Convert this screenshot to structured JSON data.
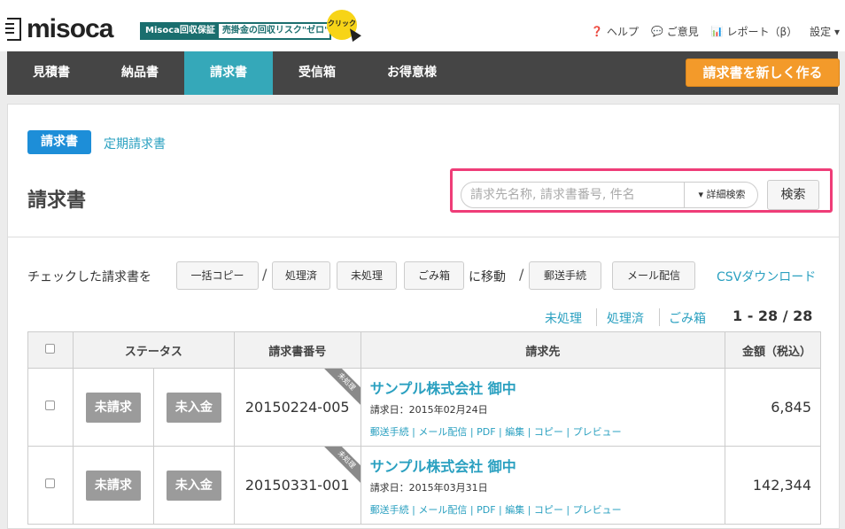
{
  "header": {
    "logo_text": "misoca",
    "banner_left": "Misoca回収保証",
    "banner_right": "売掛金の回収リスク\"ゼロ\"",
    "click_badge": "クリック",
    "utility": [
      {
        "icon": "help-icon",
        "glyph": "❓",
        "label": "ヘルプ"
      },
      {
        "icon": "feedback-icon",
        "glyph": "💬",
        "label": "ご意見"
      },
      {
        "icon": "report-icon",
        "glyph": "📊",
        "label": "レポート（β）"
      },
      {
        "icon": "settings-icon",
        "glyph": "",
        "label": "設定 ▾"
      }
    ]
  },
  "nav": {
    "tabs": [
      "見積書",
      "納品書",
      "請求書",
      "受信箱",
      "お得意様"
    ],
    "active": "請求書",
    "create_button": "請求書を新しく作る"
  },
  "subtabs": {
    "active": "請求書",
    "other": "定期請求書"
  },
  "page_title": "請求書",
  "search": {
    "placeholder": "請求先名称, 請求書番号, 件名",
    "detail_label": "▾ 詳細検索",
    "button": "検索"
  },
  "bulk_actions": {
    "label": "チェックした請求書を",
    "copy": "一括コピー",
    "sep": "/",
    "processed": "処理済",
    "unprocessed": "未処理",
    "trash": "ごみ箱",
    "move_to": "に移動",
    "sep2": "/",
    "mail_send": "郵送手続",
    "email_send": "メール配信",
    "csv": "CSVダウンロード"
  },
  "filters": [
    "未処理",
    "処理済",
    "ごみ箱"
  ],
  "pagination": "1 - 28 / 28",
  "table": {
    "headers": [
      "ステータス",
      "請求書番号",
      "請求先",
      "金額（税込）"
    ],
    "rows": [
      {
        "status1": "未請求",
        "status2": "未入金",
        "number": "20150224-005",
        "ribbon": "未処理",
        "client": "サンプル株式会社 御中",
        "date": "請求日：2015年02月24日",
        "links": "郵送手続 | メール配信 | PDF | 編集 | コピー | プレビュー",
        "amount": "6,845"
      },
      {
        "status1": "未請求",
        "status2": "未入金",
        "number": "20150331-001",
        "ribbon": "未処理",
        "client": "サンプル株式会社 御中",
        "date": "請求日：2015年03月31日",
        "links": "郵送手続 | メール配信 | PDF | 編集 | コピー | プレビュー",
        "amount": "142,344"
      }
    ]
  }
}
